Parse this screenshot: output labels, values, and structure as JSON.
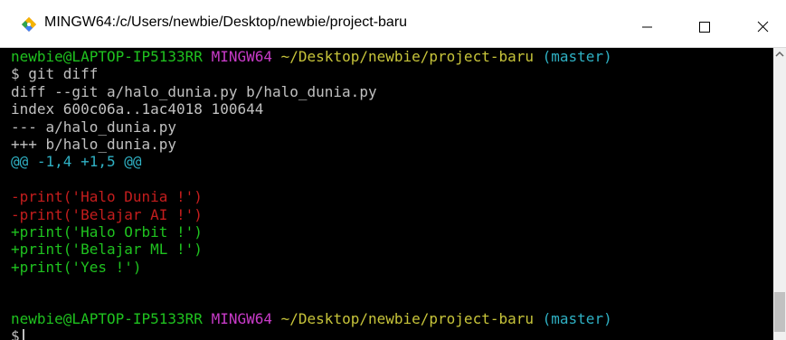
{
  "window": {
    "title": "MINGW64:/c/Users/newbie/Desktop/newbie/project-baru"
  },
  "terminal": {
    "prompt1": {
      "user": "newbie@LAPTOP-IP5133RR",
      "env": "MINGW64",
      "path": "~/Desktop/newbie/project-baru",
      "branch": "(master)"
    },
    "command": "$ git diff",
    "diff_header": [
      "diff --git a/halo_dunia.py b/halo_dunia.py",
      "index 600c06a..1ac4018 100644",
      "--- a/halo_dunia.py",
      "+++ b/halo_dunia.py"
    ],
    "hunk": "@@ -1,4 +1,5 @@",
    "removed": [
      "-print('Halo Dunia !')",
      "-print('Belajar AI !')"
    ],
    "added": [
      "+print('Halo Orbit !')",
      "+print('Belajar ML !')",
      "+print('Yes !')"
    ],
    "prompt2": {
      "user": "newbie@LAPTOP-IP5133RR",
      "env": "MINGW64",
      "path": "~/Desktop/newbie/project-baru",
      "branch": "(master)"
    },
    "input_prompt": "$"
  },
  "colors": {
    "prompt_user": "#1fc21f",
    "prompt_env": "#c93bc9",
    "prompt_path": "#c7c43a",
    "prompt_branch": "#2fb1c4",
    "diff_removed": "#c41d1d",
    "diff_added": "#1fc21f",
    "hunk_header": "#2fb1c4"
  },
  "icons": {
    "app": "git-icon",
    "minimize": "minimize-icon",
    "maximize": "maximize-icon",
    "close": "close-icon"
  }
}
